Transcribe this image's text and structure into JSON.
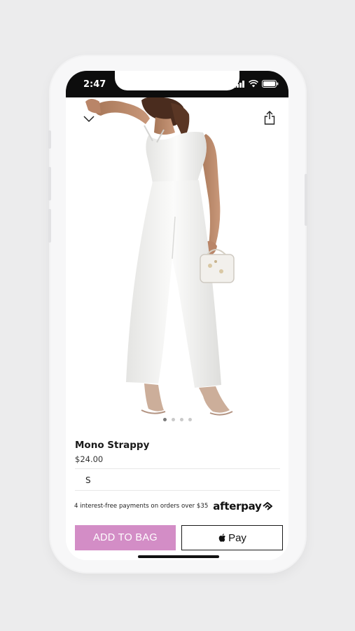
{
  "status_bar": {
    "time": "2:47"
  },
  "product": {
    "name": "Mono Strappy",
    "price": "$24.00",
    "selected_size": "S",
    "image_pages": 4,
    "active_image_page": 1
  },
  "payment_info": {
    "afterpay_text": "4 interest-free payments on orders over $35",
    "afterpay_brand": "afterpay"
  },
  "actions": {
    "add_to_bag": "ADD TO BAG",
    "apple_pay": "Pay"
  },
  "icons": {
    "back": "chevron-down-icon",
    "share": "share-icon",
    "apple": "apple-icon",
    "afterpay": "afterpay-logo-icon"
  },
  "colors": {
    "add_to_bag_bg": "#d38dc6",
    "status_bar_bg": "#0d0d0d",
    "background": "#ececed"
  }
}
